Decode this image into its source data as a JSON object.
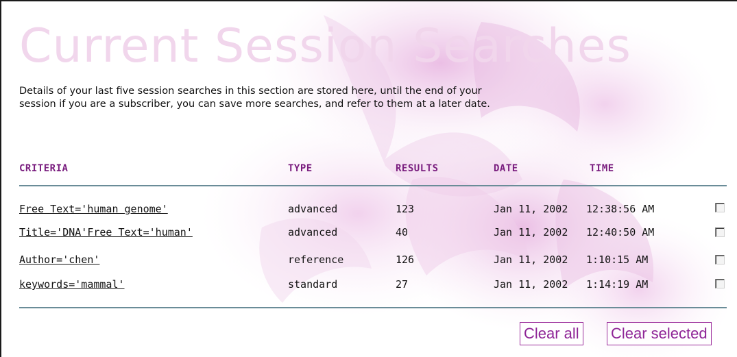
{
  "page": {
    "title": "Current Session Searches",
    "intro_line1": "Details of your last five session searches in this section are stored here, until the end of your",
    "intro_line2": "session if you are a subscriber, you can save more searches, and refer to them at a later date."
  },
  "table": {
    "headers": {
      "criteria": "CRITERIA",
      "type": "TYPE",
      "results": "RESULTS",
      "date": "DATE",
      "time": "TIME"
    },
    "rows": [
      {
        "criteria": "Free Text='human genome'",
        "type": "advanced",
        "results": "123",
        "date": "Jan 11, 2002",
        "time": "12:38:56 AM",
        "selected": false
      },
      {
        "criteria": "Title='DNA'Free Text='human'",
        "type": "advanced",
        "results": "40",
        "date": "Jan 11, 2002",
        "time": "12:40:50 AM",
        "selected": false
      },
      {
        "criteria": "Author='chen'",
        "type": "reference",
        "results": "126",
        "date": "Jan 11, 2002",
        "time": "1:10:15 AM",
        "selected": false
      },
      {
        "criteria": "keywords='mammal'",
        "type": "standard",
        "results": "27",
        "date": "Jan 11, 2002",
        "time": "1:14:19 AM",
        "selected": false
      }
    ]
  },
  "actions": {
    "clear_all": "Clear all",
    "clear_selected": "Clear selected"
  },
  "colors": {
    "title": "#f1d6ec",
    "header": "#7a1e7f",
    "rule": "#6a8c98",
    "button": "#8e2496",
    "background_art": "#e8b6e0"
  }
}
